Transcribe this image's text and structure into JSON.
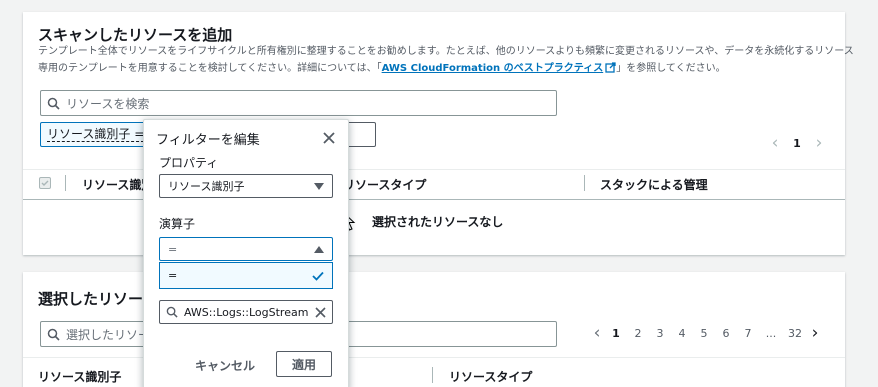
{
  "scan_section": {
    "title": "スキャンしたリソースを追加",
    "desc_line1": "テンプレート全体でリソースをライフサイクルと所有権別に整理することをお勧めします。たとえば、他のリソースよりも頻繁に変更されるリソースや、データを永続化するリソース",
    "desc_line2_prefix": "専用のテンプレートを用意することを検討してください。詳細については、「",
    "desc_link": "AWS CloudFormation のベストプラクティス",
    "desc_line2_suffix": "」を参照してください。",
    "search_placeholder": "リソースを検索",
    "filter_token": "リソース識別子 =",
    "pagination": {
      "prev": "‹",
      "page": "1",
      "next": "›"
    },
    "columns": [
      "リソース識別",
      "リソースタイプ",
      "スタックによる管理"
    ],
    "empty_text": "選択されたリソースなし"
  },
  "selected_section": {
    "title": "選択したリソー",
    "search_placeholder": "選択したリソー",
    "pagination": {
      "prev": "‹",
      "pages": [
        "1",
        "2",
        "3",
        "4",
        "5",
        "6",
        "7",
        "...",
        "32"
      ],
      "next": "›"
    },
    "columns": [
      "リソース識別子",
      "リソースタイプ"
    ]
  },
  "filter_popover": {
    "title": "フィルターを編集",
    "property_label": "プロパティ",
    "property_value": "リソース識別子",
    "operator_label": "演算子",
    "operator_value": "=",
    "operator_options": [
      "="
    ],
    "value_text": "AWS::Logs::LogStream",
    "cancel_label": "キャンセル",
    "apply_label": "適用"
  },
  "colors": {
    "link": "#0073bb",
    "accent_blue": "#0073bb",
    "border": "#879596",
    "option_bg": "#f1faff"
  }
}
